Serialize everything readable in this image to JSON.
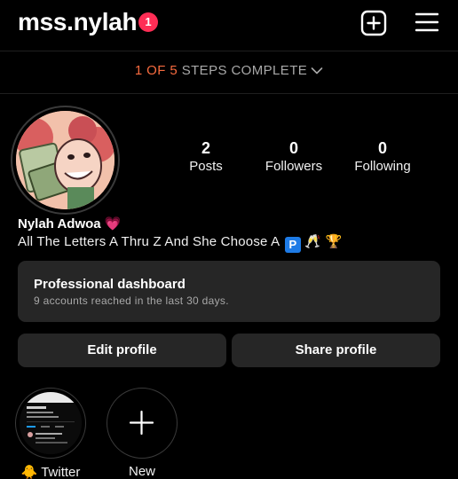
{
  "header": {
    "username": "mss.nylah",
    "notification_count": "1",
    "create_icon": "plus-square-icon",
    "menu_icon": "hamburger-menu-icon"
  },
  "steps": {
    "done": "1",
    "of": "OF",
    "total": "5",
    "text": "STEPS COMPLETE",
    "accent_color": "#f86b3f"
  },
  "profile": {
    "stats": [
      {
        "value": "2",
        "label": "Posts"
      },
      {
        "value": "0",
        "label": "Followers"
      },
      {
        "value": "0",
        "label": "Following"
      }
    ],
    "display_name": "Nylah Adwoa 💗",
    "bio_text": "All The Letters A Thru Z And She Choose A",
    "bio_badge": "P",
    "bio_emojis": "🥂 🏆"
  },
  "dashboard": {
    "title": "Professional dashboard",
    "subtitle": "9 accounts reached in the last 30 days."
  },
  "buttons": {
    "edit": "Edit profile",
    "share": "Share profile"
  },
  "highlights": [
    {
      "label": "🐥 Twitter"
    },
    {
      "label": "New"
    }
  ]
}
